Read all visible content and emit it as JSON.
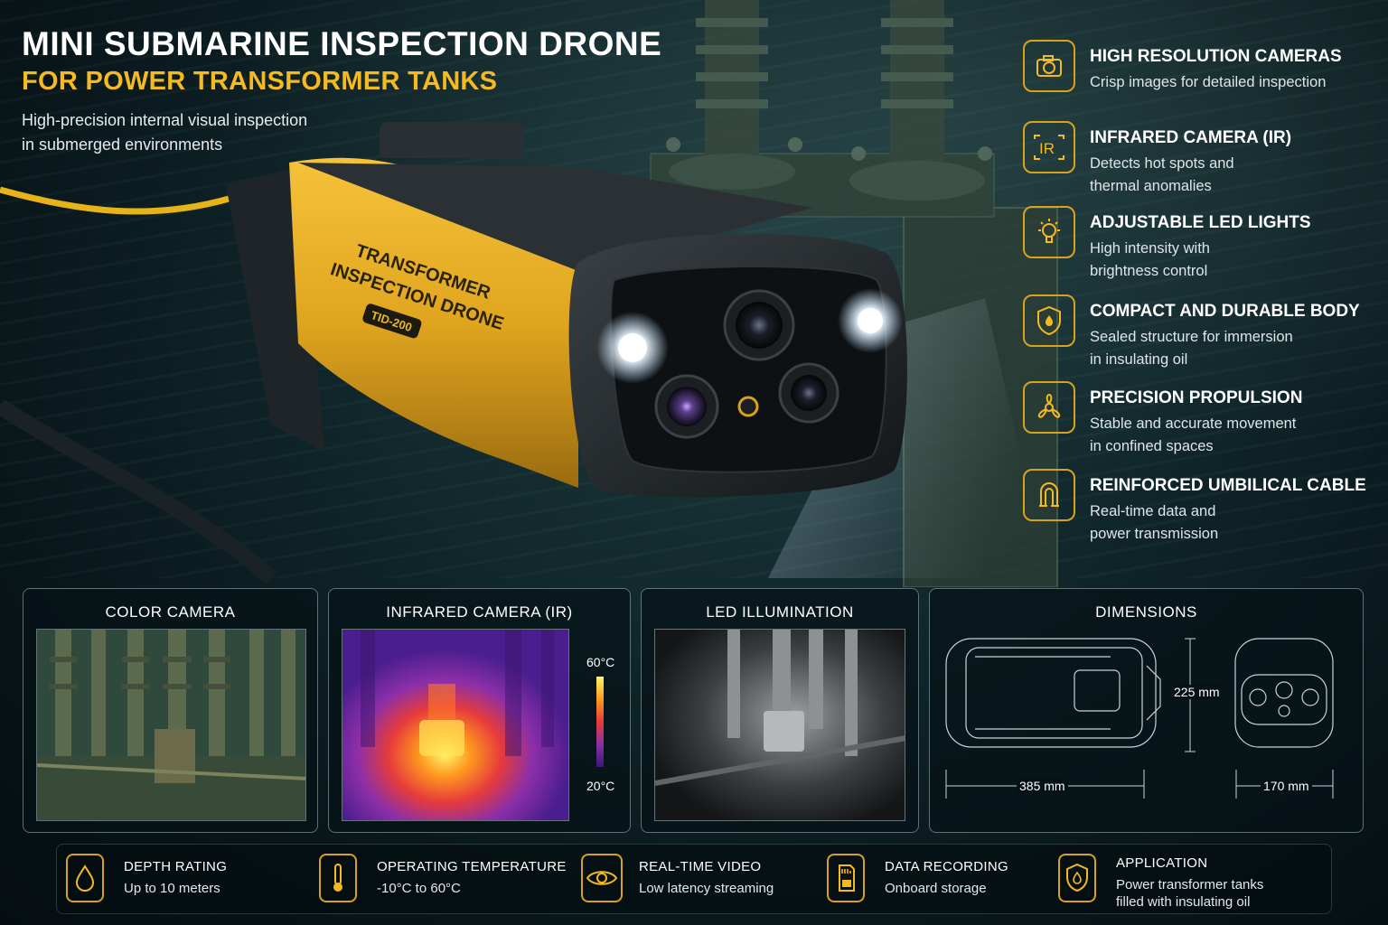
{
  "header": {
    "title_line1": "MINI SUBMARINE INSPECTION DRONE",
    "title_line2": "FOR POWER TRANSFORMER TANKS",
    "subtitle_line1": "High-precision internal visual inspection",
    "subtitle_line2": "in submerged environments"
  },
  "drone": {
    "label_line1": "TRANSFORMER",
    "label_line2": "INSPECTION DRONE",
    "model": "TID-200"
  },
  "features": [
    {
      "icon": "camera-icon",
      "title": "HIGH RESOLUTION CAMERAS",
      "desc1": "Crisp images for detailed inspection",
      "desc2": ""
    },
    {
      "icon": "ir-icon",
      "title": "INFRARED CAMERA (IR)",
      "desc1": "Detects hot spots and",
      "desc2": "thermal anomalies"
    },
    {
      "icon": "lightbulb-icon",
      "title": "ADJUSTABLE LED LIGHTS",
      "desc1": "High intensity with",
      "desc2": "brightness control"
    },
    {
      "icon": "shield-drop-icon",
      "title": "COMPACT AND DURABLE BODY",
      "desc1": "Sealed structure for immersion",
      "desc2": "in insulating oil"
    },
    {
      "icon": "propeller-icon",
      "title": "PRECISION PROPULSION",
      "desc1": "Stable and accurate movement",
      "desc2": "in confined spaces"
    },
    {
      "icon": "cable-icon",
      "title": "REINFORCED UMBILICAL CABLE",
      "desc1": "Real-time data and",
      "desc2": "power transmission"
    }
  ],
  "panels": {
    "color_camera": {
      "title": "COLOR CAMERA"
    },
    "infrared": {
      "title": "INFRARED CAMERA (IR)",
      "scale_max": "60°C",
      "scale_min": "20°C"
    },
    "led": {
      "title": "LED ILLUMINATION"
    },
    "dimensions": {
      "title": "DIMENSIONS",
      "height": "225 mm",
      "length": "385 mm",
      "width": "170 mm"
    }
  },
  "specs": [
    {
      "icon": "drop-icon",
      "title": "DEPTH RATING",
      "desc1": "Up to 10 meters",
      "desc2": ""
    },
    {
      "icon": "thermometer-icon",
      "title": "OPERATING TEMPERATURE",
      "desc1": "-10°C to 60°C",
      "desc2": ""
    },
    {
      "icon": "eye-icon",
      "title": "REAL-TIME VIDEO",
      "desc1": "Low latency streaming",
      "desc2": ""
    },
    {
      "icon": "sd-card-icon",
      "title": "DATA RECORDING",
      "desc1": "Onboard storage",
      "desc2": ""
    },
    {
      "icon": "shield-drop-icon",
      "title": "APPLICATION",
      "desc1": "Power transformer tanks",
      "desc2": "filled with insulating oil"
    }
  ],
  "colors": {
    "accent": "#f5b921",
    "icon_border": "#d8a21c",
    "drone_body": "#e0a51f",
    "background": "#0b1c20"
  }
}
